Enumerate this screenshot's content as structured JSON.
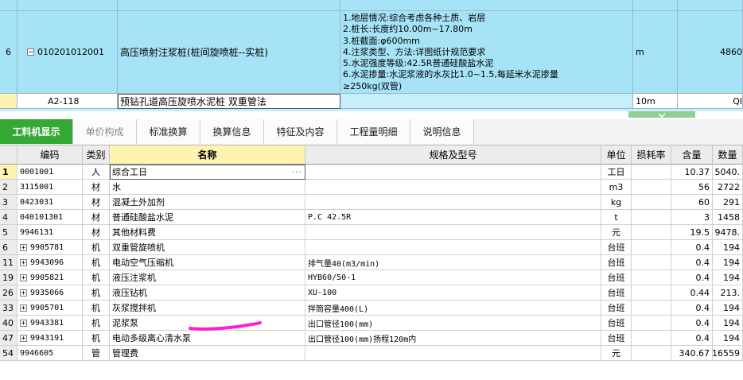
{
  "top_table": {
    "main_row": {
      "seq": "6",
      "code": "010201012001",
      "name": "高压喷射注浆桩(桩间旋喷桩--实桩)",
      "features": [
        "1.地层情况:综合考虑各种土质、岩层",
        "2.桩长:长度约10.00m~17.80m",
        "3.桩截面:φ600mm",
        "4.注浆类型、方法:详图纸计规范要求",
        "5.水泥强度等级:42.5R普通硅酸盐水泥",
        "6.水泥掺量:水泥浆液的水灰比1.0~1.5,每延米水泥掺量",
        "≥250kg(双管)"
      ],
      "unit": "m",
      "qty": "4860"
    },
    "sub_row": {
      "code": "A2-118",
      "name": "预钻孔道高压旋喷水泥桩 双重管法",
      "unit": "10m",
      "qty": "QI"
    }
  },
  "tabs": [
    {
      "label": "工料机显示",
      "active": true
    },
    {
      "label": "单价构成",
      "dim": true
    },
    {
      "label": "标准换算"
    },
    {
      "label": "换算信息"
    },
    {
      "label": "特征及内容"
    },
    {
      "label": "工程量明细"
    },
    {
      "label": "说明信息"
    }
  ],
  "grid": {
    "headers": [
      "编码",
      "类别",
      "名称",
      "规格及型号",
      "单位",
      "损耗率",
      "含量",
      "数量"
    ],
    "rows": [
      {
        "idx": "1",
        "code": "0001001",
        "cat": "人",
        "name": "综合工日",
        "spec": "",
        "unit": "工日",
        "loss": "",
        "content": "10.37",
        "qty": "5040.",
        "expand": false
      },
      {
        "idx": "2",
        "code": "3115001",
        "cat": "材",
        "name": "水",
        "spec": "",
        "unit": "m3",
        "loss": "",
        "content": "56",
        "qty": "2722",
        "expand": false
      },
      {
        "idx": "3",
        "code": "0423031",
        "cat": "材",
        "name": "混凝土外加剂",
        "spec": "",
        "unit": "kg",
        "loss": "",
        "content": "60",
        "qty": "291",
        "expand": false
      },
      {
        "idx": "4",
        "code": "040101301",
        "cat": "材",
        "name": "普通硅酸盐水泥",
        "spec": "P.C 42.5R",
        "unit": "t",
        "loss": "",
        "content": "3",
        "qty": "1458",
        "expand": false
      },
      {
        "idx": "5",
        "code": "9946131",
        "cat": "材",
        "name": "其他材料费",
        "spec": "",
        "unit": "元",
        "loss": "",
        "content": "19.5",
        "qty": "9478.",
        "expand": false
      },
      {
        "idx": "6",
        "code": "9905781",
        "cat": "机",
        "name": "双重管旋喷机",
        "spec": "",
        "unit": "台班",
        "loss": "",
        "content": "0.4",
        "qty": "194",
        "expand": true
      },
      {
        "idx": "11",
        "code": "9943096",
        "cat": "机",
        "name": "电动空气压缩机",
        "spec": "排气量40(m3/min)",
        "unit": "台班",
        "loss": "",
        "content": "0.4",
        "qty": "194",
        "expand": true
      },
      {
        "idx": "19",
        "code": "9905821",
        "cat": "机",
        "name": "液压注浆机",
        "spec": "HYB60/50-1",
        "unit": "台班",
        "loss": "",
        "content": "0.4",
        "qty": "194",
        "expand": true
      },
      {
        "idx": "26",
        "code": "9935066",
        "cat": "机",
        "name": "液压钻机",
        "spec": "XU-100",
        "unit": "台班",
        "loss": "",
        "content": "0.44",
        "qty": "213.",
        "expand": true
      },
      {
        "idx": "33",
        "code": "9905701",
        "cat": "机",
        "name": "灰浆搅拌机",
        "spec": "拌筒容量400(L)",
        "unit": "台班",
        "loss": "",
        "content": "0.4",
        "qty": "194",
        "expand": true
      },
      {
        "idx": "40",
        "code": "9943381",
        "cat": "机",
        "name": "泥浆泵",
        "spec": "出口管径100(mm)",
        "unit": "台班",
        "loss": "",
        "content": "0.4",
        "qty": "194",
        "expand": true
      },
      {
        "idx": "47",
        "code": "9943191",
        "cat": "机",
        "name": "电动多级离心清水泵",
        "spec": "出口管径100(mm)扬程120m内",
        "unit": "台班",
        "loss": "",
        "content": "0.4",
        "qty": "194",
        "expand": true
      },
      {
        "idx": "54",
        "code": "9946605",
        "cat": "管",
        "name": "管理费",
        "spec": "",
        "unit": "元",
        "loss": "",
        "content": "340.67",
        "qty": "16559",
        "expand": false
      }
    ]
  },
  "colors": {
    "row_highlight": "#a6e3f7",
    "active_tab": "#36a836",
    "selected_header": "#fff3b0",
    "annotation_stroke": "#ff1fd2"
  }
}
